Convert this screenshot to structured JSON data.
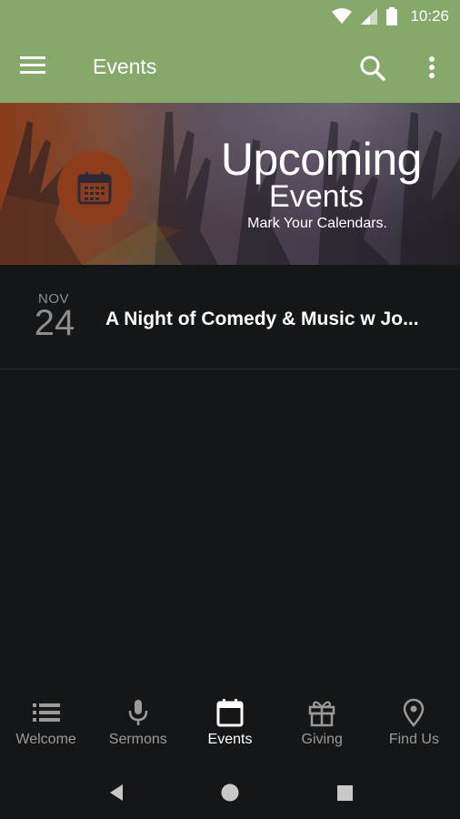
{
  "status_bar": {
    "time": "10:26"
  },
  "app_bar": {
    "title": "Events"
  },
  "banner": {
    "title": "Upcoming",
    "subtitle": "Events",
    "tagline": "Mark Your Calendars."
  },
  "events": [
    {
      "month": "NOV",
      "day": "24",
      "title": "A Night of Comedy & Music w Jo..."
    }
  ],
  "bottom_nav": [
    {
      "label": "Welcome",
      "icon": "list-icon",
      "active": false
    },
    {
      "label": "Sermons",
      "icon": "microphone-icon",
      "active": false
    },
    {
      "label": "Events",
      "icon": "calendar-icon",
      "active": true
    },
    {
      "label": "Giving",
      "icon": "gift-icon",
      "active": false
    },
    {
      "label": "Find Us",
      "icon": "location-pin-icon",
      "active": false
    }
  ],
  "colors": {
    "accent": "#85a96b",
    "background": "#151617",
    "banner_orange": "#8d3d1b"
  }
}
